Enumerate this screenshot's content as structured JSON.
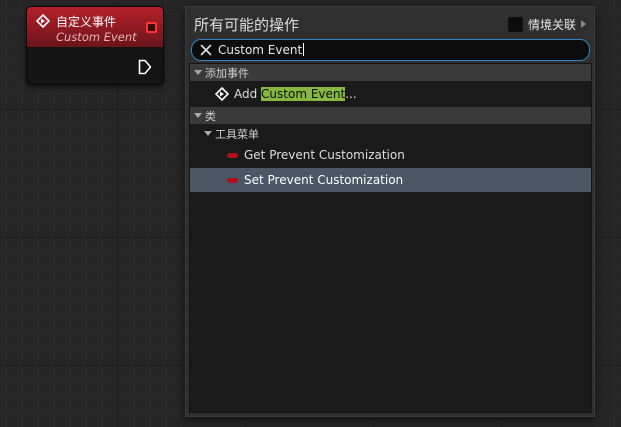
{
  "node": {
    "title": "自定义事件",
    "subtitle": "Custom Event"
  },
  "menu": {
    "title": "所有可能的操作",
    "context_label": "情境关联",
    "search_value": "Custom Event",
    "categories": [
      {
        "label": "添加事件",
        "items": [
          {
            "prefix": "Add ",
            "match": "Custom Event",
            "suffix": "..."
          }
        ]
      },
      {
        "label": "类",
        "subcategory": "工具菜单",
        "items": [
          {
            "label": "Get Prevent Customization",
            "selected": false
          },
          {
            "label": "Set Prevent Customization",
            "selected": true
          }
        ]
      }
    ]
  },
  "colors": {
    "node_header": "#b5202a",
    "search_border": "#2e86c8",
    "match_highlight": "#86b73f",
    "selected_row": "#4a5866",
    "function_pill": "#b10f1b",
    "delegate_pin": "#ff3535"
  },
  "icons": {
    "event": "event-diamond-icon",
    "exec": "exec-pin-icon",
    "delegate": "delegate-pin-icon",
    "clear": "close-icon",
    "collapse": "triangle-down-icon",
    "context_arrow": "triangle-right-icon",
    "function": "function-pill-icon"
  }
}
